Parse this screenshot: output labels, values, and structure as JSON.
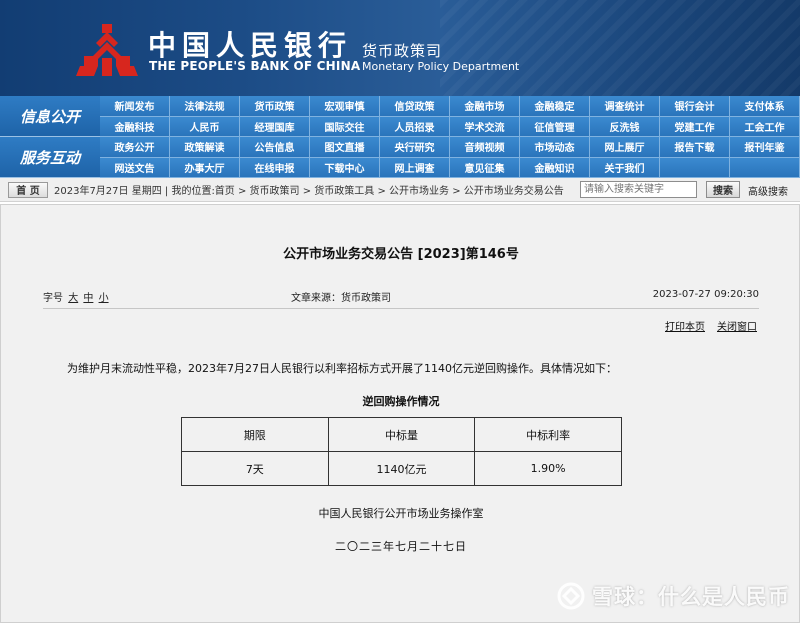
{
  "header": {
    "bank_name_cn": "中国人民银行",
    "bank_name_en": "THE PEOPLE'S BANK OF CHINA",
    "dept_cn": "货币政策司",
    "dept_en": "Monetary Policy Department",
    "brand_color": "#1c4c86",
    "logo_color": "#d7261e"
  },
  "nav": {
    "cat1": "信息公开",
    "cat2": "服务互动",
    "rows": [
      [
        "新闻发布",
        "法律法规",
        "货币政策",
        "宏观审慎",
        "信贷政策",
        "金融市场",
        "金融稳定",
        "调查统计",
        "银行会计",
        "支付体系"
      ],
      [
        "金融科技",
        "人民币",
        "经理国库",
        "国际交往",
        "人员招录",
        "学术交流",
        "征信管理",
        "反洗钱",
        "党建工作",
        "工会工作"
      ],
      [
        "政务公开",
        "政策解读",
        "公告信息",
        "图文直播",
        "央行研究",
        "音频视频",
        "市场动态",
        "网上展厅",
        "报告下载",
        "报刊年鉴"
      ],
      [
        "网送文告",
        "办事大厅",
        "在线申报",
        "下载中心",
        "网上调查",
        "意见征集",
        "金融知识",
        "关于我们",
        "",
        ""
      ]
    ]
  },
  "crumb": {
    "home": "首  页",
    "text": "2023年7月27日 星期四 | 我的位置:首页 > 货币政策司 > 货币政策工具 > 公开市场业务 > 公开市场业务交易公告",
    "search_placeholder": "请输入搜索关键字",
    "search_button": "搜索",
    "advanced_search": "高级搜索"
  },
  "article": {
    "title": "公开市场业务交易公告 [2023]第146号",
    "font_label": "字号",
    "font_large": "大",
    "font_medium": "中",
    "font_small": "小",
    "source": "文章来源：货币政策司",
    "datetime": "2023-07-27 09:20:30",
    "print": "打印本页",
    "close": "关闭窗口",
    "paragraph": "为维护月末流动性平稳，2023年7月27日人民银行以利率招标方式开展了1140亿元逆回购操作。具体情况如下：",
    "table_title": "逆回购操作情况",
    "table_headers": [
      "期限",
      "中标量",
      "中标利率"
    ],
    "table_row": [
      "7天",
      "1140亿元",
      "1.90%"
    ],
    "signature": "中国人民银行公开市场业务操作室",
    "sign_date": "二〇二三年七月二十七日"
  },
  "watermark": {
    "text": "雪球：什么是人民币"
  }
}
